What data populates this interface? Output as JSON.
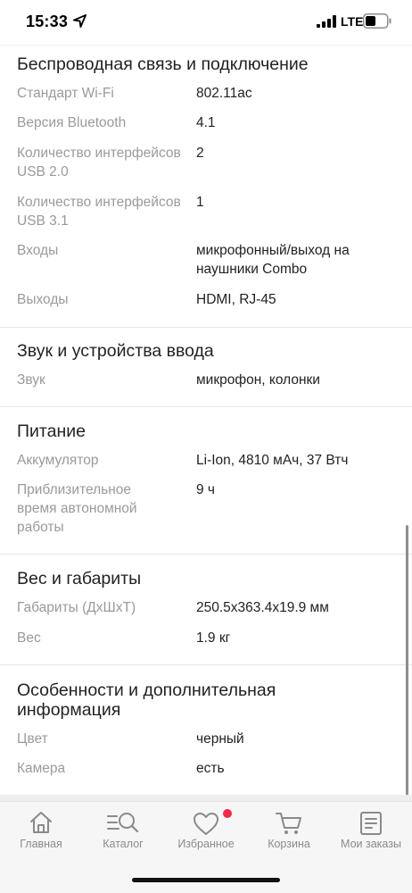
{
  "status_bar": {
    "time": "15:33",
    "network": "LTE",
    "location_icon": "location-arrow-icon",
    "signal_icon": "signal-bars-icon",
    "battery_icon": "battery-icon"
  },
  "sections": [
    {
      "title": "Беспроводная связь и подключение",
      "rows": [
        {
          "label": "Стандарт Wi-Fi",
          "value": "802.11ac"
        },
        {
          "label": "Версия Bluetooth",
          "value": "4.1"
        },
        {
          "label": "Количество интерфейсов USB 2.0",
          "value": "2"
        },
        {
          "label": "Количество интерфейсов USB 3.1",
          "value": "1"
        },
        {
          "label": "Входы",
          "value": "микрофонный/выход на наушники Combo"
        },
        {
          "label": "Выходы",
          "value": "HDMI, RJ-45"
        }
      ]
    },
    {
      "title": "Звук и устройства ввода",
      "rows": [
        {
          "label": "Звук",
          "value": "микрофон, колонки"
        }
      ]
    },
    {
      "title": "Питание",
      "rows": [
        {
          "label": "Аккумулятор",
          "value": "Li-Ion, 4810 мАч, 37 Втч"
        },
        {
          "label": "Приблизительное время автономной работы",
          "value": "9 ч"
        }
      ]
    },
    {
      "title": "Вес и габариты",
      "rows": [
        {
          "label": "Габариты (ДхШхТ)",
          "value": "250.5x363.4x19.9 мм"
        },
        {
          "label": "Вес",
          "value": "1.9 кг"
        }
      ]
    },
    {
      "title": "Особенности и дополнительная информация",
      "rows": [
        {
          "label": "Цвет",
          "value": "черный"
        },
        {
          "label": "Камера",
          "value": "есть"
        }
      ]
    }
  ],
  "tab_bar": {
    "items": [
      {
        "label": "Главная",
        "icon": "home-icon"
      },
      {
        "label": "Каталог",
        "icon": "catalog-search-icon"
      },
      {
        "label": "Избранное",
        "icon": "heart-icon",
        "badge": true
      },
      {
        "label": "Корзина",
        "icon": "cart-icon"
      },
      {
        "label": "Мои заказы",
        "icon": "orders-icon"
      }
    ],
    "badge_color": "#f0284a",
    "icon_color": "#8a8a8a"
  }
}
